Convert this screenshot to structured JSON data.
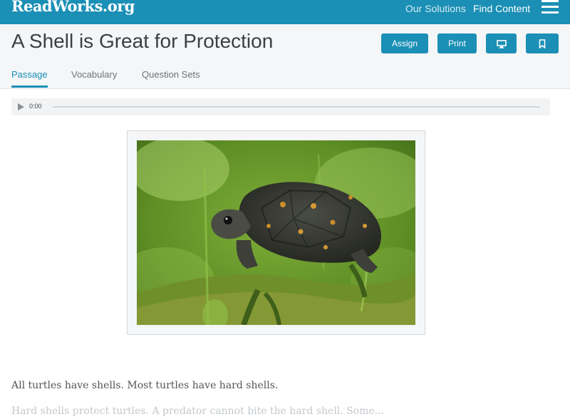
{
  "header": {
    "logo": "ReadWorks.org",
    "nav": [
      {
        "label": "Our Solutions"
      },
      {
        "label": "Find Content"
      }
    ]
  },
  "article": {
    "title": "A Shell is Great for Protection",
    "buttons": {
      "assign": "Assign",
      "print": "Print"
    },
    "tabs": [
      {
        "label": "Passage",
        "active": true
      },
      {
        "label": "Vocabulary"
      },
      {
        "label": "Question Sets"
      }
    ]
  },
  "audio": {
    "current_time": "0:00",
    "progress": 0
  },
  "passage": {
    "paragraphs": [
      "All turtles have shells. Most turtles have hard shells.",
      "Hard shells protect turtles. A predator cannot bite the hard shell. Some..."
    ]
  },
  "colors": {
    "brand": "#1b8fb5",
    "title_band": "#f4f6f7"
  }
}
